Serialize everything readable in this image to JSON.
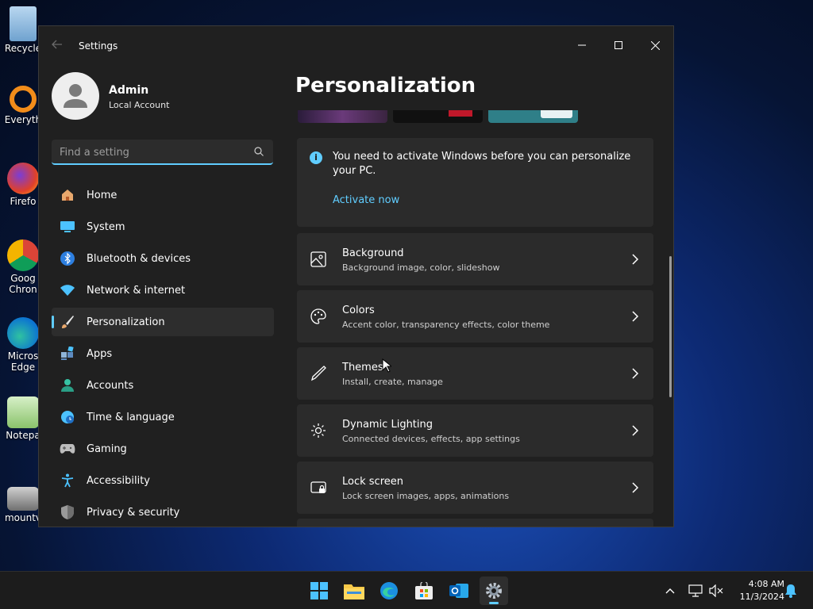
{
  "desktop": {
    "icons": [
      {
        "label": "Recycle"
      },
      {
        "label": "Everyth"
      },
      {
        "label": "Firefo"
      },
      {
        "label": "Goog",
        "label2": "Chron"
      },
      {
        "label": "Micros",
        "label2": "Edge"
      },
      {
        "label": "Notepa"
      },
      {
        "label": "mountv"
      }
    ]
  },
  "window": {
    "title": "Settings",
    "controls": {
      "minimize": "minimize",
      "maximize": "maximize",
      "close": "close"
    }
  },
  "profile": {
    "name": "Admin",
    "account_type": "Local Account"
  },
  "search": {
    "placeholder": "Find a setting",
    "value": ""
  },
  "nav": {
    "items": [
      {
        "label": "Home",
        "icon": "home-icon"
      },
      {
        "label": "System",
        "icon": "system-icon"
      },
      {
        "label": "Bluetooth & devices",
        "icon": "bluetooth-icon"
      },
      {
        "label": "Network & internet",
        "icon": "network-icon"
      },
      {
        "label": "Personalization",
        "icon": "brush-icon",
        "active": true
      },
      {
        "label": "Apps",
        "icon": "apps-icon"
      },
      {
        "label": "Accounts",
        "icon": "accounts-icon"
      },
      {
        "label": "Time & language",
        "icon": "globe-clock-icon"
      },
      {
        "label": "Gaming",
        "icon": "gamepad-icon"
      },
      {
        "label": "Accessibility",
        "icon": "accessibility-icon"
      },
      {
        "label": "Privacy & security",
        "icon": "shield-icon"
      }
    ]
  },
  "main": {
    "title": "Personalization",
    "alert": {
      "text": "You need to activate Windows before you can personalize your PC.",
      "link": "Activate now"
    },
    "cards": [
      {
        "title": "Background",
        "subtitle": "Background image, color, slideshow",
        "icon": "image-icon"
      },
      {
        "title": "Colors",
        "subtitle": "Accent color, transparency effects, color theme",
        "icon": "palette-icon"
      },
      {
        "title": "Themes",
        "subtitle": "Install, create, manage",
        "icon": "pen-icon"
      },
      {
        "title": "Dynamic Lighting",
        "subtitle": "Connected devices, effects, app settings",
        "icon": "lighting-icon"
      },
      {
        "title": "Lock screen",
        "subtitle": "Lock screen images, apps, animations",
        "icon": "lock-screen-icon"
      }
    ]
  },
  "taskbar": {
    "apps": [
      "start-icon",
      "file-explorer-icon",
      "edge-icon",
      "store-icon",
      "outlook-icon",
      "settings-icon"
    ],
    "clock": {
      "time": "4:08 AM",
      "date": "11/3/2024"
    }
  },
  "colors": {
    "accent": "#60cdff",
    "window_bg": "#202020",
    "card_bg": "#2b2b2b"
  }
}
